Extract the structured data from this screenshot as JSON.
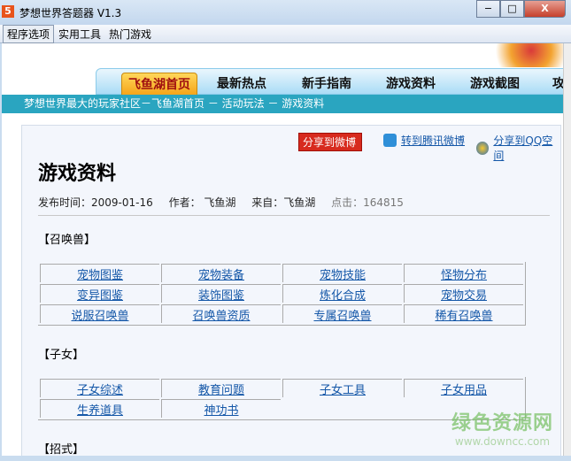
{
  "window": {
    "title": "梦想世界答题器  V1.3",
    "icon": "5",
    "minimize": "−",
    "maximize": "□",
    "close": "X"
  },
  "menu": [
    "程序选项",
    "实用工具",
    "热门游戏"
  ],
  "nav": [
    "飞鱼湖首页",
    "最新热点",
    "新手指南",
    "游戏资料",
    "游戏截图",
    "攻"
  ],
  "breadcrumb": "梦想世界最大的玩家社区－飞鱼湖首页 － 活动玩法 － 游戏资料",
  "share": {
    "weibo": "分享到微博",
    "tencent": "转到腾讯微博",
    "qzone": "分享到QQ空间"
  },
  "article": {
    "title": "游戏资料",
    "date": "发布时间：2009-01-16",
    "author": "作者： 飞鱼湖",
    "source": "来自：飞鱼湖",
    "hits": "点击：164815"
  },
  "sections": [
    {
      "title": "【召唤兽】",
      "links": [
        [
          "宠物图鉴",
          "宠物装备",
          "宠物技能",
          "怪物分布"
        ],
        [
          "变异图鉴",
          "装饰图鉴",
          "炼化合成",
          "宠物交易"
        ],
        [
          "说服召唤兽",
          "召唤兽资质",
          "专属召唤兽",
          "稀有召唤兽"
        ]
      ]
    },
    {
      "title": "【子女】",
      "links": [
        [
          "子女综述",
          "教育问题",
          "子女工具",
          "子女用品"
        ],
        [
          "生养道具",
          "神功书"
        ]
      ]
    },
    {
      "title": "【招式】"
    }
  ],
  "watermark": {
    "name": "绿色资源网",
    "url": "www.downcc.com"
  }
}
